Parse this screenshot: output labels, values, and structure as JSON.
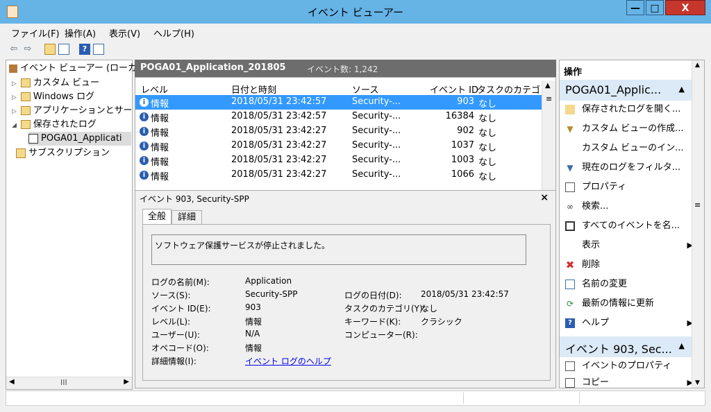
{
  "window": {
    "title": "イベント ビューアー",
    "minimize": "—",
    "maximize": "□",
    "close": "X"
  },
  "menubar": {
    "items": [
      "ファイル(F)",
      "操作(A)",
      "表示(V)",
      "ヘルプ(H)"
    ]
  },
  "tree": {
    "items": [
      {
        "label": "イベント ビューアー (ローカル)",
        "expander": ""
      },
      {
        "label": "カスタム ビュー",
        "expander": "▷"
      },
      {
        "label": "Windows ログ",
        "expander": "▷"
      },
      {
        "label": "アプリケーションとサービス ロ",
        "expander": "▷"
      },
      {
        "label": "保存されたログ",
        "expander": "◢"
      },
      {
        "label": "POGA01_Applicati",
        "expander": ""
      },
      {
        "label": "サブスクリプション",
        "expander": ""
      }
    ],
    "hscroll_thumb": "III"
  },
  "log_header": {
    "name": "POGA01_Application_201805",
    "count": "イベント数: 1,242"
  },
  "columns": [
    "レベル",
    "日付と時刻",
    "ソース",
    "イベント ID",
    "タスクのカテゴリ"
  ],
  "rows": [
    {
      "level": "情報",
      "datetime": "2018/05/31 23:42:57",
      "source": "Security-...",
      "id": "903",
      "task": "なし"
    },
    {
      "level": "情報",
      "datetime": "2018/05/31 23:42:57",
      "source": "Security-...",
      "id": "16384",
      "task": "なし"
    },
    {
      "level": "情報",
      "datetime": "2018/05/31 23:42:27",
      "source": "Security-...",
      "id": "902",
      "task": "なし"
    },
    {
      "level": "情報",
      "datetime": "2018/05/31 23:42:27",
      "source": "Security-...",
      "id": "1037",
      "task": "なし"
    },
    {
      "level": "情報",
      "datetime": "2018/05/31 23:42:27",
      "source": "Security-...",
      "id": "1003",
      "task": "なし"
    },
    {
      "level": "情報",
      "datetime": "2018/05/31 23:42:27",
      "source": "Security-...",
      "id": "1066",
      "task": "なし"
    }
  ],
  "detail": {
    "title": "イベント 903, Security-SPP",
    "close": "×",
    "tabs": [
      "全般",
      "詳細"
    ],
    "message": "ソフトウェア保護サービスが停止されました。",
    "fields_left": [
      {
        "label": "ログの名前(M):",
        "value": "Application"
      },
      {
        "label": "ソース(S):",
        "value": "Security-SPP"
      },
      {
        "label": "イベント ID(E):",
        "value": "903"
      },
      {
        "label": "レベル(L):",
        "value": "情報"
      },
      {
        "label": "ユーザー(U):",
        "value": "N/A"
      },
      {
        "label": "オペコード(O):",
        "value": "情報"
      },
      {
        "label": "詳細情報(I):",
        "value": "イベント ログのヘルプ"
      }
    ],
    "fields_right": [
      {
        "label": "ログの日付(D):",
        "value": "2018/05/31 23:42:57"
      },
      {
        "label": "タスクのカテゴリ(Y):",
        "value": "なし"
      },
      {
        "label": "キーワード(K):",
        "value": "クラシック"
      },
      {
        "label": "コンピューター(R):",
        "value": ""
      }
    ]
  },
  "actions": {
    "header": "操作",
    "section1": "POGA01_Applic...",
    "items1": [
      {
        "label": "保存されたログを開く...",
        "icon": "folder-open-icon",
        "arrow": ""
      },
      {
        "label": "カスタム ビューの作成...",
        "icon": "filter-icon",
        "arrow": ""
      },
      {
        "label": "カスタム ビューのイン...",
        "icon": "",
        "arrow": ""
      },
      {
        "label": "現在のログをフィルタ...",
        "icon": "filter-icon",
        "arrow": ""
      },
      {
        "label": "プロパティ",
        "icon": "properties-icon",
        "arrow": ""
      },
      {
        "label": "検索...",
        "icon": "binoculars-icon",
        "arrow": ""
      },
      {
        "label": "すべてのイベントを名...",
        "icon": "save-icon",
        "arrow": ""
      },
      {
        "label": "表示",
        "icon": "",
        "arrow": "▶"
      },
      {
        "label": "削除",
        "icon": "delete-icon",
        "arrow": ""
      },
      {
        "label": "名前の変更",
        "icon": "rename-icon",
        "arrow": ""
      },
      {
        "label": "最新の情報に更新",
        "icon": "refresh-icon",
        "arrow": ""
      },
      {
        "label": "ヘルプ",
        "icon": "help-icon",
        "arrow": "▶"
      }
    ],
    "section2": "イベント 903, Sec...",
    "items2": [
      {
        "label": "イベントのプロパティ",
        "icon": "properties-icon",
        "arrow": ""
      },
      {
        "label": "コピー",
        "icon": "copy-icon",
        "arrow": "▶"
      }
    ]
  },
  "colors": {
    "titlebar": "#66b3e6",
    "close_button": "#c7362c",
    "selected_row": "#3399ff",
    "header_bar": "#6d6d6d",
    "section_header": "#dceaf7",
    "link": "#0000ee"
  }
}
